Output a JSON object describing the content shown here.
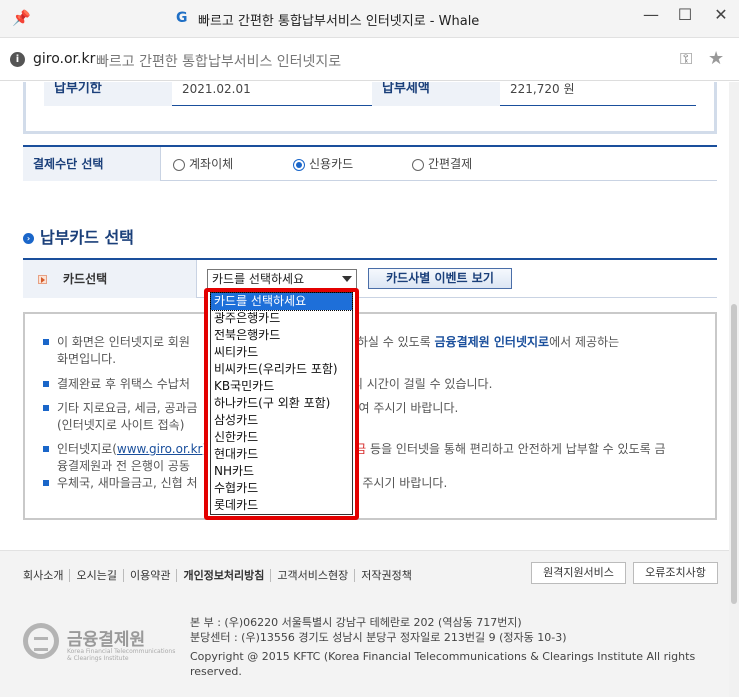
{
  "window": {
    "title": "빠르고 간편한 통합납부서비스 인터넷지로 - Whale",
    "favicon": "G",
    "controls": {
      "minimize": "—",
      "maximize": "☐",
      "close": "✕"
    }
  },
  "addressbar": {
    "domain": "giro.or.kr",
    "page_title": "빠르고 간편한 통합납부서비스 인터넷지로"
  },
  "payment_info": {
    "due_label": "납부기한",
    "due_value": "2021.02.01",
    "amount_label": "납부세액",
    "amount_value": "221,720 원"
  },
  "payment_method": {
    "label": "결제수단 선택",
    "options": [
      {
        "label": "계좌이체",
        "selected": false
      },
      {
        "label": "신용카드",
        "selected": true
      },
      {
        "label": "간편결제",
        "selected": false
      }
    ]
  },
  "card_section": {
    "heading": "납부카드 선택",
    "row_label": "카드선택",
    "select_value": "카드를 선택하세요",
    "event_button": "카드사별 이벤트 보기",
    "options": [
      "카드를 선택하세요",
      "광주은행카드",
      "전북은행카드",
      "씨티카드",
      "비씨카드(우리카드 포함)",
      "KB국민카드",
      "하나카드(구 외환 포함)",
      "삼성카드",
      "신한카드",
      "현대카드",
      "NH카드",
      "수협카드",
      "롯데카드"
    ],
    "highlight_color": "#e30000"
  },
  "notices": {
    "n1_pre": "이 화면은 인터넷지로 회원",
    "n1_mid": "를 이용하실 수 있도록 ",
    "n1_hl": "금융결제원 인터넷지로",
    "n1_post": "에서 제공하는",
    "n1_line2": "화면입니다.",
    "n2_pre": "결제완료 후 위택스 수납처",
    "n2_post": "리 시간이 걸릴 수 있습니다.",
    "n3_pre": "기타 지로요금, 세금, 공과금",
    "n3_post": "하여 주시기 바랍니다.",
    "n3_line2": "(인터넷지로 사이트 접속)",
    "n4_pre": "인터넷지로(",
    "n4_link": "www.giro.or.kr",
    "n4_mid": ")",
    "n4_red": "금",
    "n4_post": " 등을 인터넷을 통해 편리하고 안전하게 납부할 수 있도록 금",
    "n4_line2": "융결제원과 전 은행이 공동",
    "n5_pre": "우체국, 새마을금고, 신협 처",
    "n5_post": "여 주시기 바랍니다."
  },
  "footer": {
    "nav": [
      "회사소개",
      "오시는길",
      "이용약관",
      "개인정보처리방침",
      "고객서비스현장",
      "저작권정책"
    ],
    "btn_remote": "원격지원서비스",
    "btn_error": "오류조치사항",
    "logo_name": "금융결제원",
    "logo_sub1": "Korea Financial Telecommunications",
    "logo_sub2": "& Clearings Institute",
    "addr1": "본  부 : (우)06220 서울특별시 강남구 테헤란로 202 (역삼동 717번지)",
    "addr2": "분당센터 : (우)13556 경기도 성남시 분당구 정자일로 213번길 9 (정자동 10-3)",
    "copyright": "Copyright @ 2015 KFTC (Korea Financial Telecommunications & Clearings Institute All rights reserved."
  }
}
